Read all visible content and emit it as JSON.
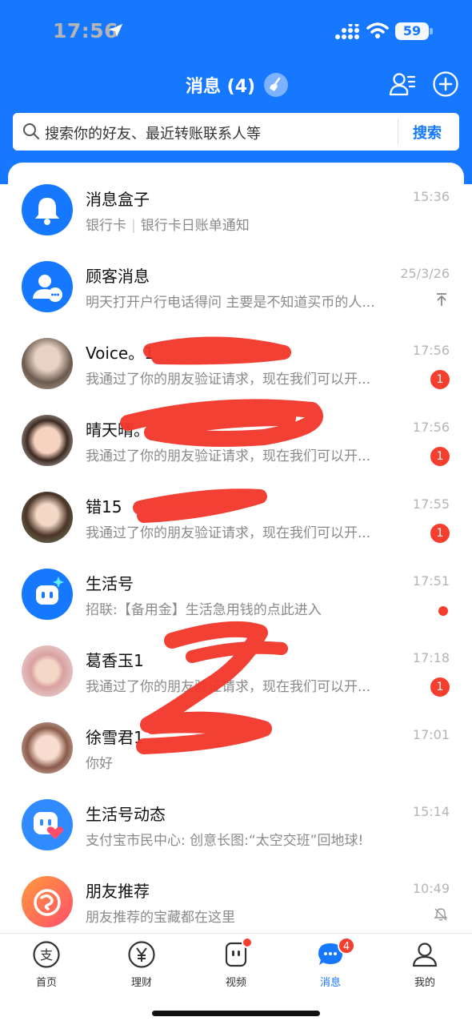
{
  "status_bar": {
    "time": "17:56",
    "battery": "59"
  },
  "header": {
    "title": "消息 (4)"
  },
  "search": {
    "placeholder": "搜索你的好友、最近转账联系人等",
    "button": "搜索"
  },
  "messages": [
    {
      "name": "消息盒子",
      "subtitle_tag": "银行卡",
      "subtitle": "银行卡日账单通知",
      "time": "15:36",
      "avatar": "bell-icon"
    },
    {
      "name": "顾客消息",
      "subtitle": "明天打开户行电话得问 主要是不知道买币的人...",
      "time": "25/3/26",
      "avatar": "customer-service-icon",
      "pinned": true
    },
    {
      "name": "Voice。1",
      "subtitle": "我通过了你的朋友验证请求，现在我们可以开...",
      "time": "17:56",
      "badge": "1",
      "avatar": "photo"
    },
    {
      "name": "晴天晴。",
      "subtitle": "我通过了你的朋友验证请求，现在我们可以开...",
      "time": "17:56",
      "badge": "1",
      "avatar": "photo"
    },
    {
      "name": "错15",
      "subtitle": "我通过了你的朋友验证请求，现在我们可以开...",
      "time": "17:55",
      "badge": "1",
      "avatar": "photo"
    },
    {
      "name": "生活号",
      "subtitle": "招联:【备用金】生活急用钱的点此进入",
      "time": "17:51",
      "dot": true,
      "avatar": "life-account-icon"
    },
    {
      "name": "葛香玉1",
      "subtitle": "我通过了你的朋友验证请求，现在我们可以开...",
      "time": "17:18",
      "badge": "1",
      "avatar": "photo"
    },
    {
      "name": "徐雪君1",
      "subtitle": "你好",
      "time": "17:01",
      "avatar": "photo"
    },
    {
      "name": "生活号动态",
      "subtitle": "支付宝市民中心: 创意长图:“太空交班”回地球!",
      "time": "15:14",
      "avatar": "life-feed-icon"
    },
    {
      "name": "朋友推荐",
      "subtitle": "朋友推荐的宝藏都在这里",
      "time": "10:49",
      "muted": true,
      "avatar": "friend-recommend-icon"
    }
  ],
  "tabs": [
    {
      "label": "首页",
      "icon": "alipay-icon"
    },
    {
      "label": "理财",
      "icon": "yuan-icon"
    },
    {
      "label": "视频",
      "icon": "video-icon",
      "dot": true
    },
    {
      "label": "消息",
      "icon": "chat-icon",
      "badge": "4",
      "active": true
    },
    {
      "label": "我的",
      "icon": "user-icon"
    }
  ],
  "colors": {
    "brand_blue": "#1677ff",
    "badge_red": "#f53f2e",
    "scribble_red": "#f2362b"
  }
}
